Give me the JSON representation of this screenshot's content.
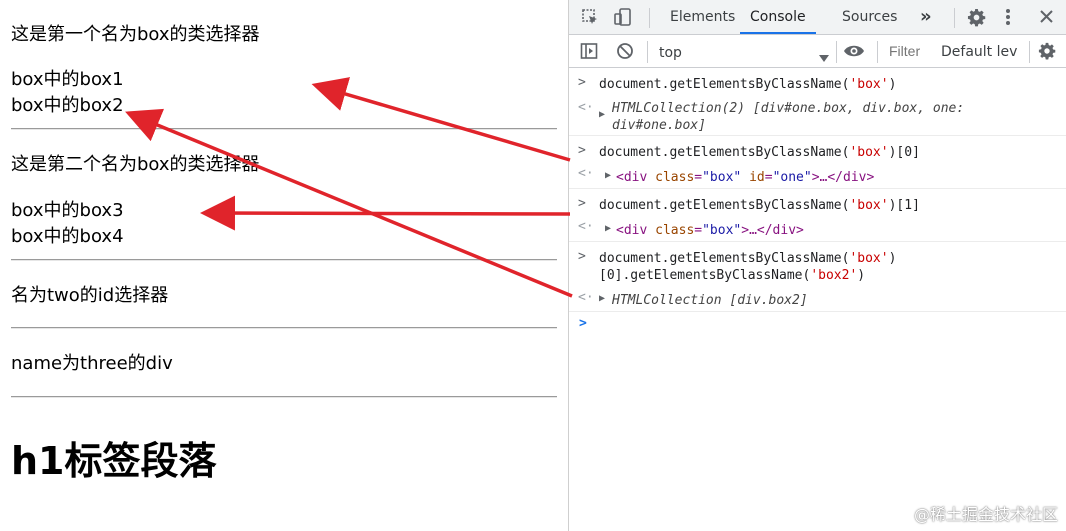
{
  "page": {
    "line1": "这是第一个名为box的类选择器",
    "line2": "box中的box1",
    "line3": "box中的box2",
    "line4": "这是第二个名为box的类选择器",
    "line5": "box中的box3",
    "line6": "box中的box4",
    "line7": "名为two的id选择器",
    "line8": "name为three的div",
    "heading": "h1标签段落"
  },
  "devtools": {
    "tabs": [
      "Elements",
      "Console",
      "Sources"
    ],
    "active_tab": "Console",
    "more_tabs": "»",
    "context": "top",
    "filter_placeholder": "Filter",
    "level": "Default lev",
    "icons": [
      "inspect-icon",
      "device-icon",
      "gear-icon",
      "kebab-menu-icon",
      "close-icon",
      "sidebar-toggle-icon",
      "clear-console-icon",
      "eye-icon"
    ]
  },
  "console": {
    "e1_in_a": "document.getElementsByClassName(",
    "e1_in_str": "'box'",
    "e1_in_b": ")",
    "e1_out_a": "HTMLCollection(2) [div#one.box, div.box, one:",
    "e1_out_b": "div#one.box]",
    "e2_in_a": "document.getElementsByClassName(",
    "e2_in_str": "'box'",
    "e2_in_b": ")[0]",
    "e2_out_lt": "<div ",
    "e2_out_attr1": "class",
    "e2_out_val1": "\"box\"",
    "e2_out_attr2": "id",
    "e2_out_val2": "\"one\"",
    "e2_out_end": ">…</div>",
    "e3_in_a": "document.getElementsByClassName(",
    "e3_in_str": "'box'",
    "e3_in_b": ")[1]",
    "e3_out_lt": "<div ",
    "e3_out_attr1": "class",
    "e3_out_val1": "\"box\"",
    "e3_out_end": ">…</div>",
    "e4_in_a": "document.getElementsByClassName(",
    "e4_in_str": "'box'",
    "e4_in_b": ")",
    "e4_in_c": "[0].getElementsByClassName(",
    "e4_in_str2": "'box2'",
    "e4_in_d": ")",
    "e4_out": "HTMLCollection [div.box2]",
    "prompt": ">"
  },
  "watermark": "@稀土掘金技术社区"
}
